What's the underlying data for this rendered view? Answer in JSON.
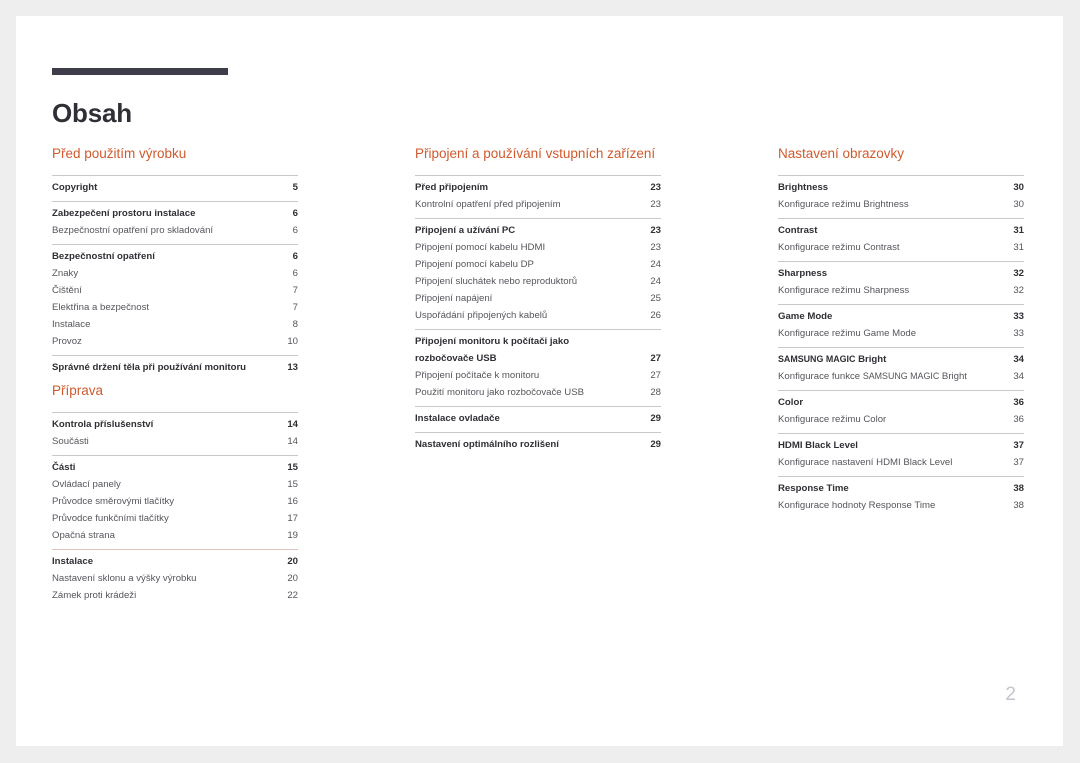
{
  "document": {
    "title": "Obsah",
    "folio": "2"
  },
  "columns": [
    {
      "id": "column-1",
      "sections": [
        {
          "heading": "Před použitím výrobku",
          "groups": [
            {
              "tinted": false,
              "entries": [
                {
                  "label": "Copyright",
                  "page": "5",
                  "level": "main"
                }
              ]
            },
            {
              "tinted": false,
              "entries": [
                {
                  "label": "Zabezpečení prostoru instalace",
                  "page": "6",
                  "level": "main"
                },
                {
                  "label": "Bezpečnostní opatření pro skladování",
                  "page": "6",
                  "level": "sub"
                }
              ]
            },
            {
              "tinted": false,
              "entries": [
                {
                  "label": "Bezpečnostní opatření",
                  "page": "6",
                  "level": "main"
                },
                {
                  "label": "Znaky",
                  "page": "6",
                  "level": "sub"
                },
                {
                  "label": "Čištění",
                  "page": "7",
                  "level": "sub"
                },
                {
                  "label": "Elektřina a bezpečnost",
                  "page": "7",
                  "level": "sub"
                },
                {
                  "label": "Instalace",
                  "page": "8",
                  "level": "sub"
                },
                {
                  "label": "Provoz",
                  "page": "10",
                  "level": "sub"
                }
              ]
            },
            {
              "tinted": false,
              "entries": [
                {
                  "label": "Správné držení těla při používání monitoru",
                  "page": "13",
                  "level": "main"
                }
              ]
            }
          ]
        },
        {
          "heading": "Příprava",
          "groups": [
            {
              "tinted": false,
              "entries": [
                {
                  "label": "Kontrola příslušenství",
                  "page": "14",
                  "level": "main"
                },
                {
                  "label": "Součásti",
                  "page": "14",
                  "level": "sub"
                }
              ]
            },
            {
              "tinted": false,
              "entries": [
                {
                  "label": "Části",
                  "page": "15",
                  "level": "main"
                },
                {
                  "label": "Ovládací panely",
                  "page": "15",
                  "level": "sub"
                },
                {
                  "label": "Průvodce směrovými tlačítky",
                  "page": "16",
                  "level": "sub"
                },
                {
                  "label": "Průvodce funkčními tlačítky",
                  "page": "17",
                  "level": "sub"
                },
                {
                  "label": "Opačná strana",
                  "page": "19",
                  "level": "sub"
                }
              ]
            },
            {
              "tinted": true,
              "entries": [
                {
                  "label": "Instalace",
                  "page": "20",
                  "level": "main"
                },
                {
                  "label": "Nastavení sklonu a výšky výrobku",
                  "page": "20",
                  "level": "sub"
                },
                {
                  "label": "Zámek proti krádeži",
                  "page": "22",
                  "level": "sub"
                }
              ]
            }
          ]
        }
      ]
    },
    {
      "id": "column-2",
      "sections": [
        {
          "heading": "Připojení a používání vstupních zařízení",
          "groups": [
            {
              "tinted": false,
              "entries": [
                {
                  "label": "Před připojením",
                  "page": "23",
                  "level": "main"
                },
                {
                  "label": "Kontrolní opatření před připojením",
                  "page": "23",
                  "level": "sub"
                }
              ]
            },
            {
              "tinted": false,
              "entries": [
                {
                  "label": "Připojení a užívání PC",
                  "page": "23",
                  "level": "main"
                },
                {
                  "label": "Připojení pomocí kabelu HDMI",
                  "page": "23",
                  "level": "sub"
                },
                {
                  "label": "Připojení pomocí kabelu DP",
                  "page": "24",
                  "level": "sub"
                },
                {
                  "label": "Připojení sluchátek nebo reproduktorů",
                  "page": "24",
                  "level": "sub"
                },
                {
                  "label": "Připojení napájení",
                  "page": "25",
                  "level": "sub"
                },
                {
                  "label": "Uspořádání připojených kabelů",
                  "page": "26",
                  "level": "sub"
                }
              ]
            },
            {
              "tinted": false,
              "entries": [
                {
                  "label": "Připojení monitoru k počítači jako rozbočovače USB",
                  "page": "27",
                  "level": "wrap"
                },
                {
                  "label": "Připojení počítače k monitoru",
                  "page": "27",
                  "level": "sub"
                },
                {
                  "label": "Použití monitoru jako rozbočovače USB",
                  "page": "28",
                  "level": "sub"
                }
              ]
            },
            {
              "tinted": false,
              "entries": [
                {
                  "label": "Instalace ovladače",
                  "page": "29",
                  "level": "main"
                }
              ]
            },
            {
              "tinted": false,
              "entries": [
                {
                  "label": "Nastavení optimálního rozlišení",
                  "page": "29",
                  "level": "main"
                }
              ]
            }
          ]
        }
      ]
    },
    {
      "id": "column-3",
      "sections": [
        {
          "heading": "Nastavení obrazovky",
          "groups": [
            {
              "tinted": false,
              "entries": [
                {
                  "label": "Brightness",
                  "page": "30",
                  "level": "main"
                },
                {
                  "label": "Konfigurace režimu Brightness",
                  "page": "30",
                  "level": "sub"
                }
              ]
            },
            {
              "tinted": false,
              "entries": [
                {
                  "label": "Contrast",
                  "page": "31",
                  "level": "main"
                },
                {
                  "label": "Konfigurace režimu Contrast",
                  "page": "31",
                  "level": "sub"
                }
              ]
            },
            {
              "tinted": false,
              "entries": [
                {
                  "label": "Sharpness",
                  "page": "32",
                  "level": "main"
                },
                {
                  "label": "Konfigurace režimu Sharpness",
                  "page": "32",
                  "level": "sub"
                }
              ]
            },
            {
              "tinted": false,
              "entries": [
                {
                  "label": "Game Mode",
                  "page": "33",
                  "level": "main"
                },
                {
                  "label": "Konfigurace režimu Game Mode",
                  "page": "33",
                  "level": "sub"
                }
              ]
            },
            {
              "tinted": false,
              "entries": [
                {
                  "label": "SAMSUNG MAGIC Bright",
                  "page": "34",
                  "level": "main"
                },
                {
                  "label": "Konfigurace funkce SAMSUNG MAGIC Bright",
                  "page": "34",
                  "level": "sub"
                }
              ]
            },
            {
              "tinted": false,
              "entries": [
                {
                  "label": "Color",
                  "page": "36",
                  "level": "main"
                },
                {
                  "label": "Konfigurace režimu Color",
                  "page": "36",
                  "level": "sub"
                }
              ]
            },
            {
              "tinted": false,
              "entries": [
                {
                  "label": "HDMI Black Level",
                  "page": "37",
                  "level": "main"
                },
                {
                  "label": "Konfigurace nastavení HDMI Black Level",
                  "page": "37",
                  "level": "sub"
                }
              ]
            },
            {
              "tinted": false,
              "entries": [
                {
                  "label": "Response Time",
                  "page": "38",
                  "level": "main"
                },
                {
                  "label": "Konfigurace hodnoty Response Time",
                  "page": "38",
                  "level": "sub"
                }
              ]
            }
          ]
        }
      ]
    }
  ],
  "colors": {
    "heading_orange": "#d05a2d",
    "title_bar": "#3e3d4a",
    "rule": "#c9c9c9",
    "rule_tinted": "#dcc4bc",
    "folio": "#c2c6cc",
    "page_background": "#ffffff",
    "canvas_background": "#efeeee"
  }
}
